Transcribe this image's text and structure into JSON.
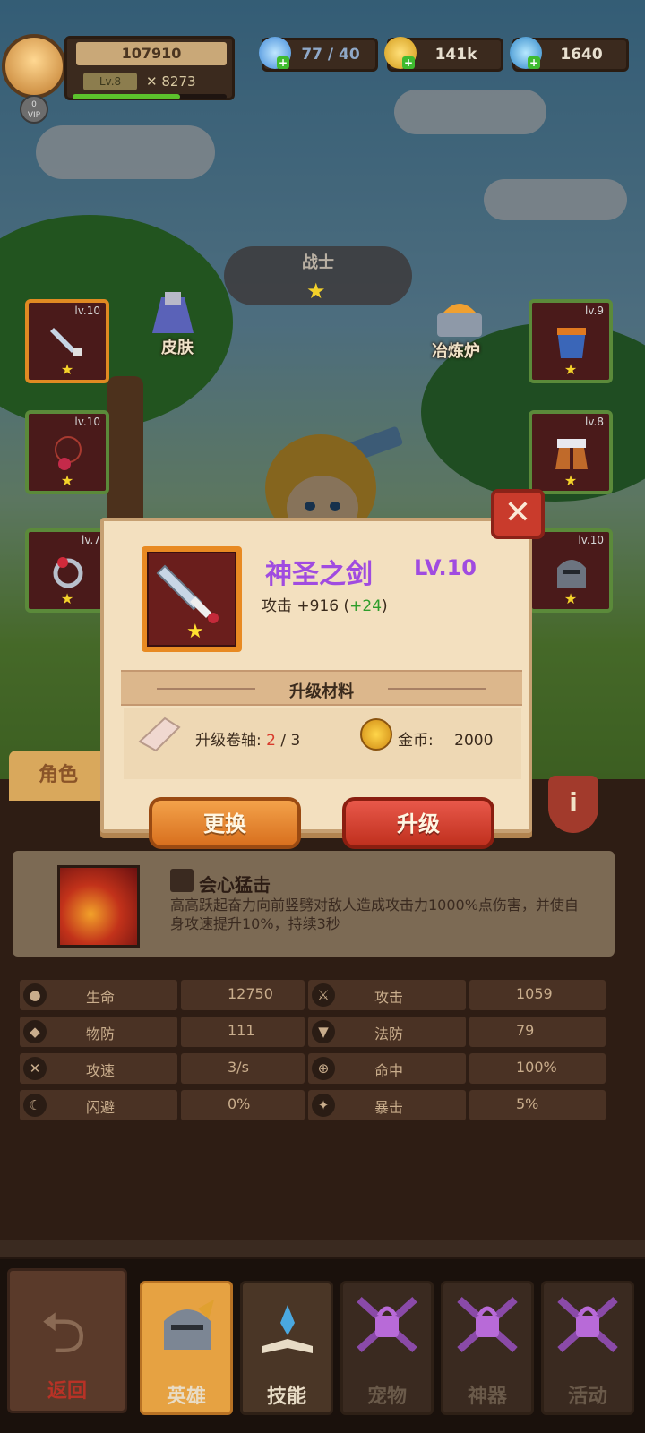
{
  "header": {
    "score": "107910",
    "level": "Lv.8",
    "power": "8273",
    "vip": "0",
    "vip_label": "VIP",
    "xp_percent": 70,
    "stamina": "77 / 40",
    "gold": "141k",
    "gems": "1640"
  },
  "hero": {
    "class_name": "战士",
    "class_stars": "★",
    "skin_label": "皮肤",
    "forge_label": "冶炼炉"
  },
  "equipment": [
    {
      "slot": "weapon",
      "level": "lv.10",
      "stars": "★"
    },
    {
      "slot": "necklace",
      "level": "lv.10",
      "stars": "★"
    },
    {
      "slot": "ring",
      "level": "lv.7",
      "stars": "★"
    },
    {
      "slot": "armor",
      "level": "lv.9",
      "stars": "★"
    },
    {
      "slot": "boots",
      "level": "lv.8",
      "stars": "★"
    },
    {
      "slot": "helmet",
      "level": "lv.10",
      "stars": "★"
    }
  ],
  "tab_role": "角色",
  "skill": {
    "name": "会心猛击",
    "description": "高高跃起奋力向前竖劈对敌人造成攻击力1000%点伤害，并使自身攻速提升10%，持续3秒"
  },
  "stats": [
    {
      "label": "生命",
      "value": "12750",
      "icon": "drop-icon"
    },
    {
      "label": "攻击",
      "value": "1059",
      "icon": "sword-icon"
    },
    {
      "label": "物防",
      "value": "111",
      "icon": "shield-icon"
    },
    {
      "label": "法防",
      "value": "79",
      "icon": "magic-shield-icon"
    },
    {
      "label": "攻速",
      "value": "3/s",
      "icon": "crossed-swords-icon"
    },
    {
      "label": "命中",
      "value": "100%",
      "icon": "crosshair-icon"
    },
    {
      "label": "闪避",
      "value": "0%",
      "icon": "dodge-icon"
    },
    {
      "label": "暴击",
      "value": "5%",
      "icon": "crit-icon"
    }
  ],
  "modal": {
    "close": "✕",
    "item_name": "神圣之剑",
    "item_level": "LV.10",
    "attr_prefix": "攻击 +916 (",
    "attr_bonus": "+24",
    "attr_suffix": ")",
    "item_stars": "★",
    "materials_title": "升级材料",
    "scroll_label": "升级卷轴:",
    "scroll_have": "2",
    "scroll_need": " / 3",
    "coin_label": "金币:",
    "coin_amount": "2000",
    "change_button": "更换",
    "upgrade_button": "升级"
  },
  "nav": {
    "back": "返回",
    "tabs": [
      "英雄",
      "技能",
      "宠物",
      "神器",
      "活动"
    ]
  },
  "colors": {
    "accent_purple": "#a04be0",
    "bonus_green": "#2e9d2a",
    "deficit_red": "#d83a2c",
    "star_yellow": "#f4d22a"
  }
}
